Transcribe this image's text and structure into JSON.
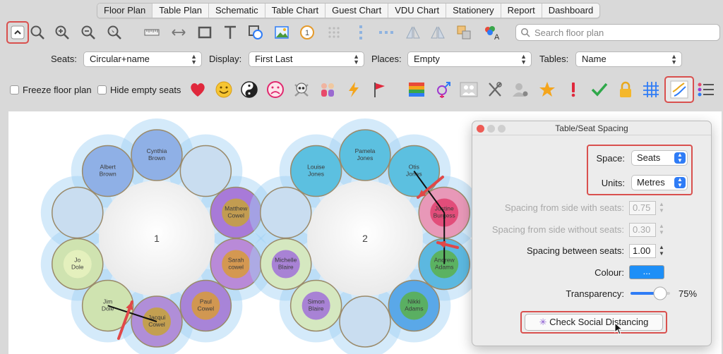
{
  "tabs": [
    "Floor Plan",
    "Table Plan",
    "Schematic",
    "Table Chart",
    "Guest Chart",
    "VDU Chart",
    "Stationery",
    "Report",
    "Dashboard"
  ],
  "active_tab": "Floor Plan",
  "search": {
    "placeholder": "Search floor plan"
  },
  "options": {
    "seats_label": "Seats:",
    "seats_value": "Circular+name",
    "display_label": "Display:",
    "display_value": "First Last",
    "places_label": "Places:",
    "places_value": "Empty",
    "tables_label": "Tables:",
    "tables_value": "Name"
  },
  "checkboxes": {
    "freeze": "Freeze floor plan",
    "hide_empty": "Hide empty seats"
  },
  "tables": [
    {
      "number": "1",
      "seats": [
        "Cynthia Brown",
        "",
        "Matthew Cowel",
        "Sarah cowel",
        "Paul Cowel",
        "Jacqui Cowel",
        "Jim Dole",
        "Jo Dole",
        "",
        "Albert Brown"
      ]
    },
    {
      "number": "2",
      "seats": [
        "Pamela Jones",
        "Otis Jones",
        "Justine Burgess",
        "Andrew Adams",
        "Nikki Adams",
        "",
        "Simon Blaire",
        "Michelle Blaire",
        "",
        "Louise Jones"
      ]
    }
  ],
  "dialog": {
    "title": "Table/Seat Spacing",
    "space_label": "Space:",
    "space_value": "Seats",
    "units_label": "Units:",
    "units_value": "Metres",
    "side_with_seats_label": "Spacing from side with seats:",
    "side_with_seats_value": "0.75",
    "side_without_seats_label": "Spacing from side without seats:",
    "side_without_seats_value": "0.30",
    "between_seats_label": "Spacing between seats:",
    "between_seats_value": "1.00",
    "colour_label": "Colour:",
    "colour_button": "...",
    "transparency_label": "Transparency:",
    "transparency_value": "75%",
    "transparency_level": 0.75,
    "check_button": "Check Social Distancing"
  },
  "colors": {
    "accent": "#2f7cf6",
    "highlight": "#d9504e",
    "zone": "#9fd0f5",
    "swatch": "#1e8ff7"
  }
}
